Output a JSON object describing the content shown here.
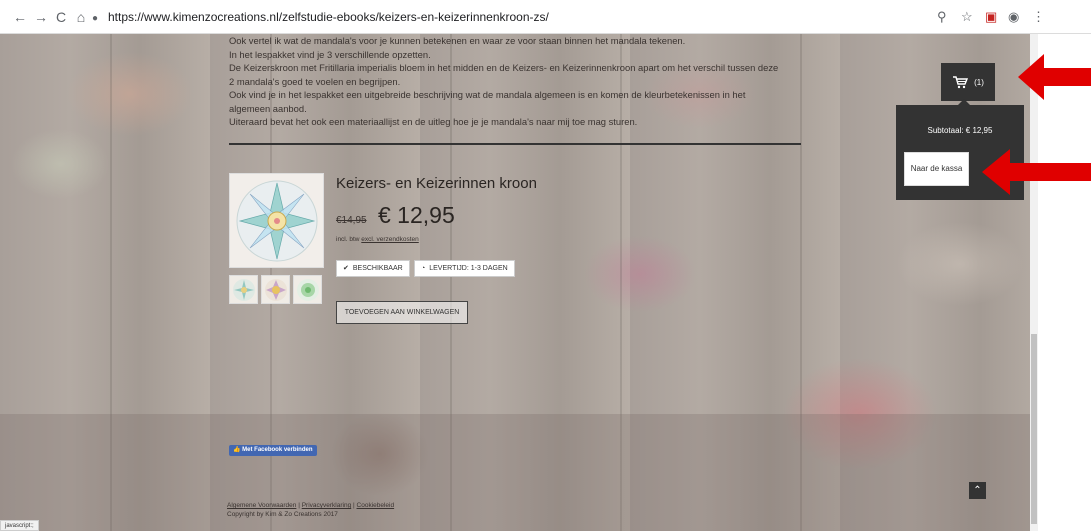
{
  "browser": {
    "url": "https://www.kimenzocreations.nl/zelfstudie-ebooks/keizers-en-keizerinnenkroon-zs/",
    "back_icon": "←",
    "forward_icon": "→",
    "reload_icon": "C",
    "home_icon": "⌂",
    "lock_icon": "🔒",
    "zoom_icon": "⚲",
    "star_icon": "☆",
    "ext_icon": "▣",
    "profile_icon": "◉",
    "menu_icon": "⋮"
  },
  "description": {
    "lines": [
      "Ook vertel ik wat de mandala's voor je kunnen betekenen en waar ze voor staan binnen het mandala tekenen.",
      "In het lespakket vind je 3 verschillende opzetten.",
      "De Keizerskroon met Fritillaria imperialis bloem in het midden en de Keizers- en Keizerinnenkroon apart om het verschil tussen deze",
      "2 mandala's goed te voelen en begrijpen.",
      "Ook vind je in het lespakket een uitgebreide beschrijving wat de mandala algemeen is en komen de kleurbetekenissen in het",
      "algemeen aanbod.",
      "Uiteraard bevat het ook een materiaallijst en de uitleg hoe je je mandala's naar mij toe mag sturen."
    ]
  },
  "product": {
    "title": "Keizers- en Keizerinnen kroon",
    "old_price": "€14,95",
    "price": "€ 12,95",
    "incl_text": "incl. btw",
    "shipping_link": "excl. verzendkosten",
    "available": "BESCHIKBAAR",
    "delivery": "LEVERTIJD: 1-3 DAGEN",
    "add_to_cart": "TOEVOEGEN AAN WINKELWAGEN"
  },
  "cart": {
    "count": "(1)",
    "subtotal": "Subtotaal: € 12,95",
    "checkout": "Naar de kassa"
  },
  "footer": {
    "facebook": "Met Facebook verbinden",
    "link1": "Algemene Voorwaarden",
    "sep": " | ",
    "link2": "Privacyverklaring",
    "link3": "Cookiebeleid",
    "copyright": "Copyright by Kim & Zo Creations 2017"
  },
  "status_bar": "javascript:;",
  "colors": {
    "arrow": "#e00000",
    "cart_bg": "#333333"
  }
}
